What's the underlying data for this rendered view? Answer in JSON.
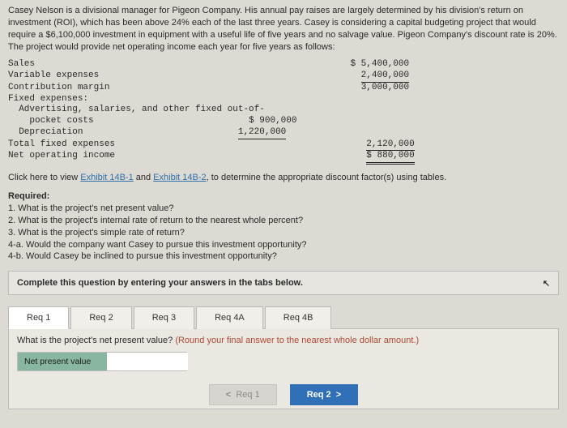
{
  "intro": "Casey Nelson is a divisional manager for Pigeon Company. His annual pay raises are largely determined by his division's return on investment (ROI), which has been above 24% each of the last three years. Casey is considering a capital budgeting project that would require a $6,100,000 investment in equipment with a useful life of five years and no salvage value. Pigeon Company's discount rate is 20%. The project would provide net operating income each year for five years as follows:",
  "fin": {
    "sales_label": "Sales",
    "sales_val": "$ 5,400,000",
    "varexp_label": "Variable expenses",
    "varexp_val": "2,400,000",
    "cm_label": "Contribution margin",
    "cm_val": "3,000,000",
    "fixed_hdr": "Fixed expenses:",
    "adv_label": "Advertising, salaries, and other fixed out-of-",
    "pocket_label": "pocket costs",
    "adv_val": "$ 900,000",
    "dep_label": "Depreciation",
    "dep_val": "1,220,000",
    "tfe_label": "Total fixed expenses",
    "tfe_val": "2,120,000",
    "noi_label": "Net operating income",
    "noi_val": "$ 880,000"
  },
  "exhibit": {
    "prefix": "Click here to view ",
    "ex1": "Exhibit 14B-1",
    "mid": " and ",
    "ex2": "Exhibit 14B-2",
    "suffix": ", to determine the appropriate discount factor(s) using tables."
  },
  "required": {
    "hdr": "Required:",
    "q1": "1. What is the project's net present value?",
    "q2": "2. What is the project's internal rate of return to the nearest whole percent?",
    "q3": "3. What is the project's simple rate of return?",
    "q4a": "4-a. Would the company want Casey to pursue this investment opportunity?",
    "q4b": "4-b. Would Casey be inclined to pursue this investment opportunity?"
  },
  "instruction": "Complete this question by entering your answers in the tabs below.",
  "tabs": {
    "t1": "Req 1",
    "t2": "Req 2",
    "t3": "Req 3",
    "t4a": "Req 4A",
    "t4b": "Req 4B"
  },
  "panel": {
    "q": "What is the project's net present value? ",
    "hint": "(Round your final answer to the nearest whole dollar amount.)",
    "label": "Net present value",
    "value": ""
  },
  "nav": {
    "prev": "Req 1",
    "next": "Req 2"
  }
}
